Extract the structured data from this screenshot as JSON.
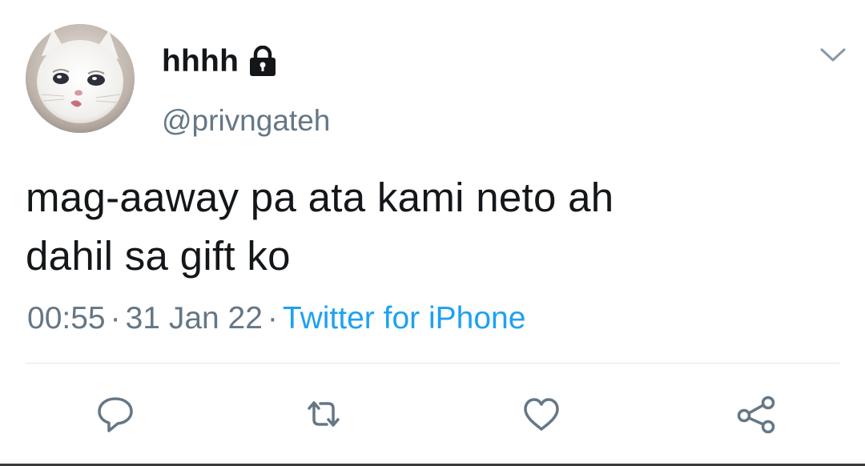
{
  "tweet": {
    "display_name": "hhhh",
    "handle": "@privngateh",
    "text_lines": [
      "mag-aaway pa ata kami neto ah",
      "dahil sa gift ko"
    ],
    "time": "00:55",
    "separator": "·",
    "date": "31 Jan 22",
    "source": "Twitter for iPhone"
  },
  "icons": {
    "lock": "lock-icon",
    "more": "chevron-down-icon",
    "reply": "reply-icon",
    "retweet": "retweet-icon",
    "like": "heart-icon",
    "share": "share-icon"
  },
  "colors": {
    "text": "#14171a",
    "secondary": "#657786",
    "link": "#1da1f2",
    "divider": "#e1e8ed"
  }
}
